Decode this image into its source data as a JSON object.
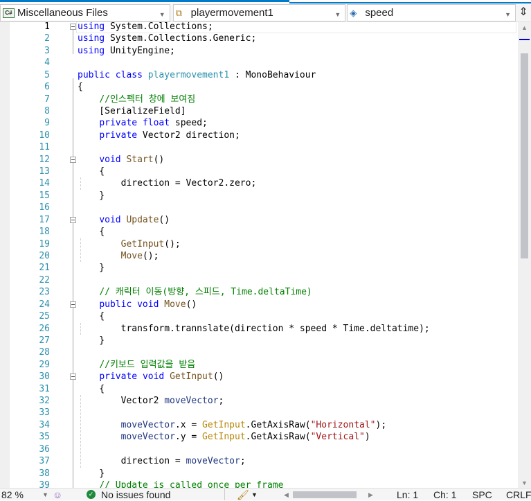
{
  "navbar": {
    "project": "Miscellaneous Files",
    "project_icon": "C#",
    "class": "playermovement1",
    "member": "speed"
  },
  "editor": {
    "current_line": 1,
    "fold_lines": [
      1,
      12,
      17,
      24,
      30
    ],
    "colors": {
      "keyword": "#0000ff",
      "type": "#2b91af",
      "method": "#74531f",
      "comment": "#008000",
      "string": "#a31515",
      "local": "#1f377f"
    },
    "lines": [
      [
        [
          "k",
          "using"
        ],
        [
          "p",
          " System.Collections;"
        ]
      ],
      [
        [
          "k",
          "using"
        ],
        [
          "p",
          " System.Collections.Generic;"
        ]
      ],
      [
        [
          "k",
          "using"
        ],
        [
          "p",
          " UnityEngine;"
        ]
      ],
      [],
      [
        [
          "k",
          "public"
        ],
        [
          "p",
          " "
        ],
        [
          "k",
          "class"
        ],
        [
          "p",
          " "
        ],
        [
          "t",
          "playermovement1"
        ],
        [
          "p",
          " : MonoBehaviour"
        ]
      ],
      [
        [
          "p",
          "{"
        ]
      ],
      [
        [
          "p",
          "    "
        ],
        [
          "c",
          "//인스펙터 창에 보여짐"
        ]
      ],
      [
        [
          "p",
          "    [SerializeField]"
        ]
      ],
      [
        [
          "p",
          "    "
        ],
        [
          "k",
          "private"
        ],
        [
          "p",
          " "
        ],
        [
          "k",
          "float"
        ],
        [
          "p",
          " speed;"
        ]
      ],
      [
        [
          "p",
          "    "
        ],
        [
          "k",
          "private"
        ],
        [
          "p",
          " Vector2 direction;"
        ]
      ],
      [],
      [
        [
          "p",
          "    "
        ],
        [
          "k",
          "void"
        ],
        [
          "p",
          " "
        ],
        [
          "m",
          "Start"
        ],
        [
          "p",
          "()"
        ]
      ],
      [
        [
          "p",
          "    {"
        ]
      ],
      [
        [
          "p",
          "        direction = Vector2.zero;"
        ]
      ],
      [
        [
          "p",
          "    }"
        ]
      ],
      [],
      [
        [
          "p",
          "    "
        ],
        [
          "k",
          "void"
        ],
        [
          "p",
          " "
        ],
        [
          "m",
          "Update"
        ],
        [
          "p",
          "()"
        ]
      ],
      [
        [
          "p",
          "    {"
        ]
      ],
      [
        [
          "p",
          "        "
        ],
        [
          "m",
          "GetInput"
        ],
        [
          "p",
          "();"
        ]
      ],
      [
        [
          "p",
          "        "
        ],
        [
          "m",
          "Move"
        ],
        [
          "p",
          "();"
        ]
      ],
      [
        [
          "p",
          "    }"
        ]
      ],
      [],
      [
        [
          "p",
          "    "
        ],
        [
          "c",
          "// 캐릭터 이동(방향, 스피드, Time.deltaTime)"
        ]
      ],
      [
        [
          "p",
          "    "
        ],
        [
          "k",
          "public"
        ],
        [
          "p",
          " "
        ],
        [
          "k",
          "void"
        ],
        [
          "p",
          " "
        ],
        [
          "m",
          "Move"
        ],
        [
          "p",
          "()"
        ]
      ],
      [
        [
          "p",
          "    {"
        ]
      ],
      [
        [
          "p",
          "        transform.trannslate(direction * speed * Time.deltatime);"
        ]
      ],
      [
        [
          "p",
          "    }"
        ]
      ],
      [],
      [
        [
          "p",
          "    "
        ],
        [
          "c",
          "//키보드 입력값을 받음"
        ]
      ],
      [
        [
          "p",
          "    "
        ],
        [
          "k",
          "private"
        ],
        [
          "p",
          " "
        ],
        [
          "k",
          "void"
        ],
        [
          "p",
          " "
        ],
        [
          "m",
          "GetInput"
        ],
        [
          "p",
          "()"
        ]
      ],
      [
        [
          "p",
          "    {"
        ]
      ],
      [
        [
          "p",
          "        Vector2 "
        ],
        [
          "v",
          "moveVector"
        ],
        [
          "p",
          ";"
        ]
      ],
      [],
      [
        [
          "p",
          "        "
        ],
        [
          "v",
          "moveVector"
        ],
        [
          "p",
          ".x = "
        ],
        [
          "u",
          "GetInput"
        ],
        [
          "p",
          ".GetAxisRaw("
        ],
        [
          "s",
          "\"Horizontal\""
        ],
        [
          "p",
          ");"
        ]
      ],
      [
        [
          "p",
          "        "
        ],
        [
          "v",
          "moveVector"
        ],
        [
          "p",
          ".y = "
        ],
        [
          "u",
          "GetInput"
        ],
        [
          "p",
          ".GetAxisRaw("
        ],
        [
          "s",
          "\"Vertical\""
        ],
        [
          "p",
          ")"
        ]
      ],
      [],
      [
        [
          "p",
          "        direction = "
        ],
        [
          "v",
          "moveVector"
        ],
        [
          "p",
          ";"
        ]
      ],
      [
        [
          "p",
          "    }"
        ]
      ],
      [
        [
          "p",
          "    "
        ],
        [
          "c",
          "// Update is called once per frame"
        ]
      ]
    ]
  },
  "status": {
    "zoom": "82 %",
    "issues": "No issues found",
    "line": "Ln: 1",
    "char": "Ch: 1",
    "spacing": "SPC",
    "eol": "CRLF"
  }
}
